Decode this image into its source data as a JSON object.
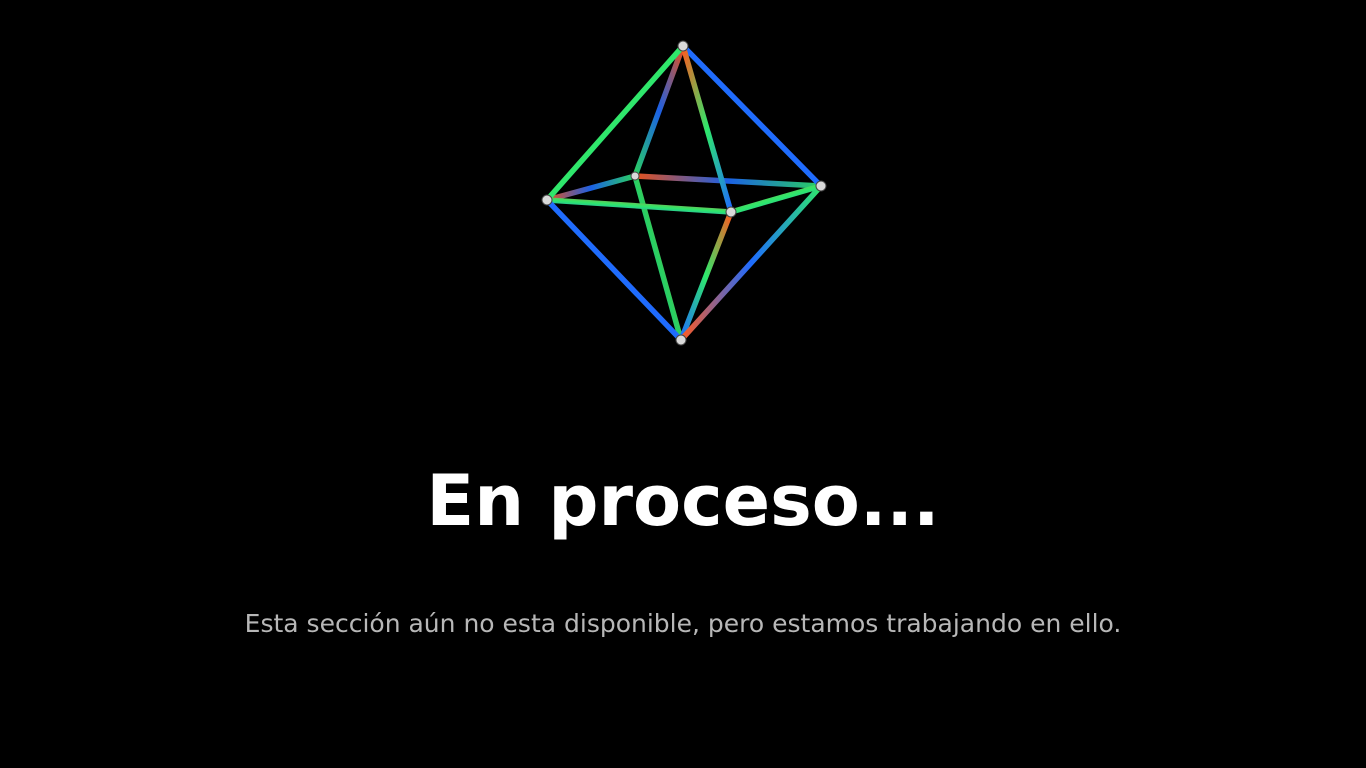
{
  "main": {
    "title": "En proceso...",
    "subtitle": "Esta sección aún no esta disponible, pero estamos trabajando en ello."
  },
  "graphic": {
    "icon": "wireframe-octahedron-icon",
    "colors": [
      "#ff5a1f",
      "#2ee86b",
      "#1e6bff",
      "#ffffff"
    ]
  },
  "theme": {
    "background": "#000000",
    "title_color": "#ffffff",
    "subtitle_color": "#b7b7b7"
  }
}
